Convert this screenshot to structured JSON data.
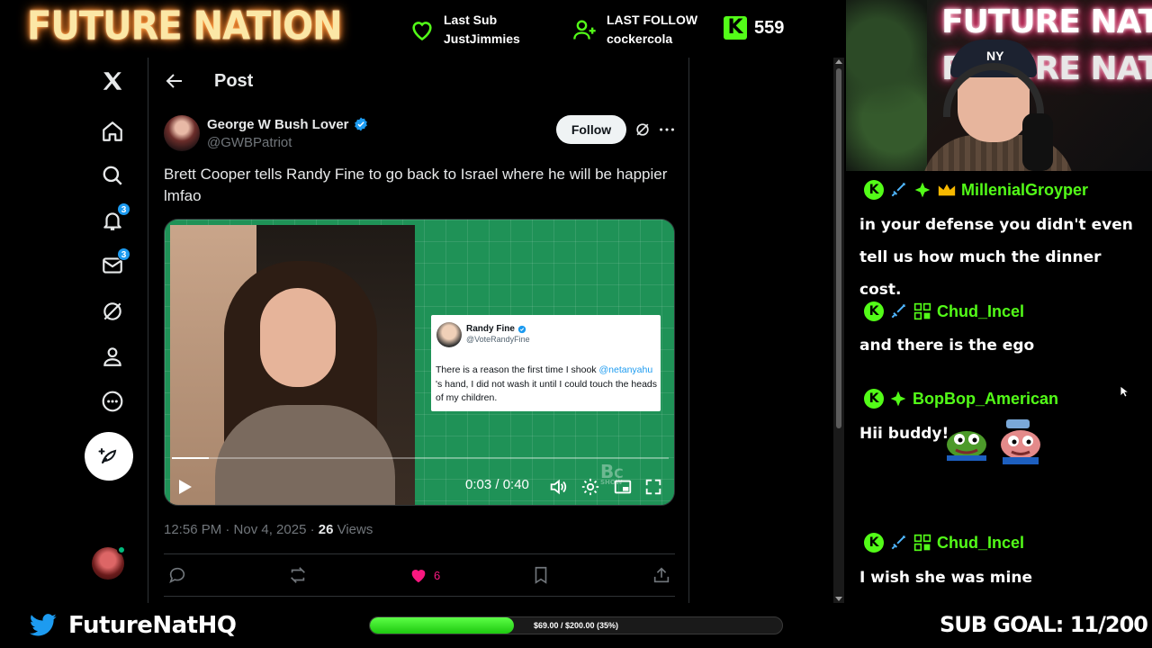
{
  "stream": {
    "brand": "FUTURE NATION",
    "last_sub_label": "Last Sub",
    "last_sub_name": "JustJimmies",
    "last_follow_label": "LAST FOLLOW",
    "last_follow_name": "cockercola",
    "kick_count": "559",
    "kick_letter": "K",
    "accent": "#53fc18"
  },
  "x": {
    "header_title": "Post",
    "nav": {
      "notifications_badge": "3",
      "messages_badge": "3"
    },
    "post": {
      "author_name": "George W Bush Lover",
      "author_handle": "@GWBPatriot",
      "follow_label": "Follow",
      "text": "Brett Cooper tells Randy Fine to go back to Israel where he will be happier lmfao",
      "video": {
        "time": "0:03 / 0:40",
        "progress": 0.075,
        "watermark": "BRETT COOPER SHOW",
        "quoted": {
          "name": "Randy Fine",
          "handle": "@VoteRandyFine",
          "text_before": "There is a reason the first time I shook ",
          "mention": "@netanyahu",
          "text_after": " 's hand, I did not wash it until I could touch the heads of my children."
        }
      },
      "timestamp": "12:56 PM · Nov 4, 2025 · ",
      "views_count": "26",
      "views_label": " Views",
      "likes": "6"
    }
  },
  "chat": [
    {
      "user": "MillenialGroyper",
      "text": "in your defense you didn't even tell us how much the dinner cost."
    },
    {
      "user": "Chud_Incel",
      "text": "and there is the ego"
    },
    {
      "user": "BopBop_American",
      "text": "Hii buddy!"
    },
    {
      "user": "Chud_Incel",
      "text": "I wish she was mine"
    }
  ],
  "bottom": {
    "twitter_handle": "FutureNatHQ",
    "goal_text": "$69.00 / $200.00 (35%)",
    "goal_fraction": 0.35,
    "sub_goal": "SUB GOAL: 11/200"
  }
}
